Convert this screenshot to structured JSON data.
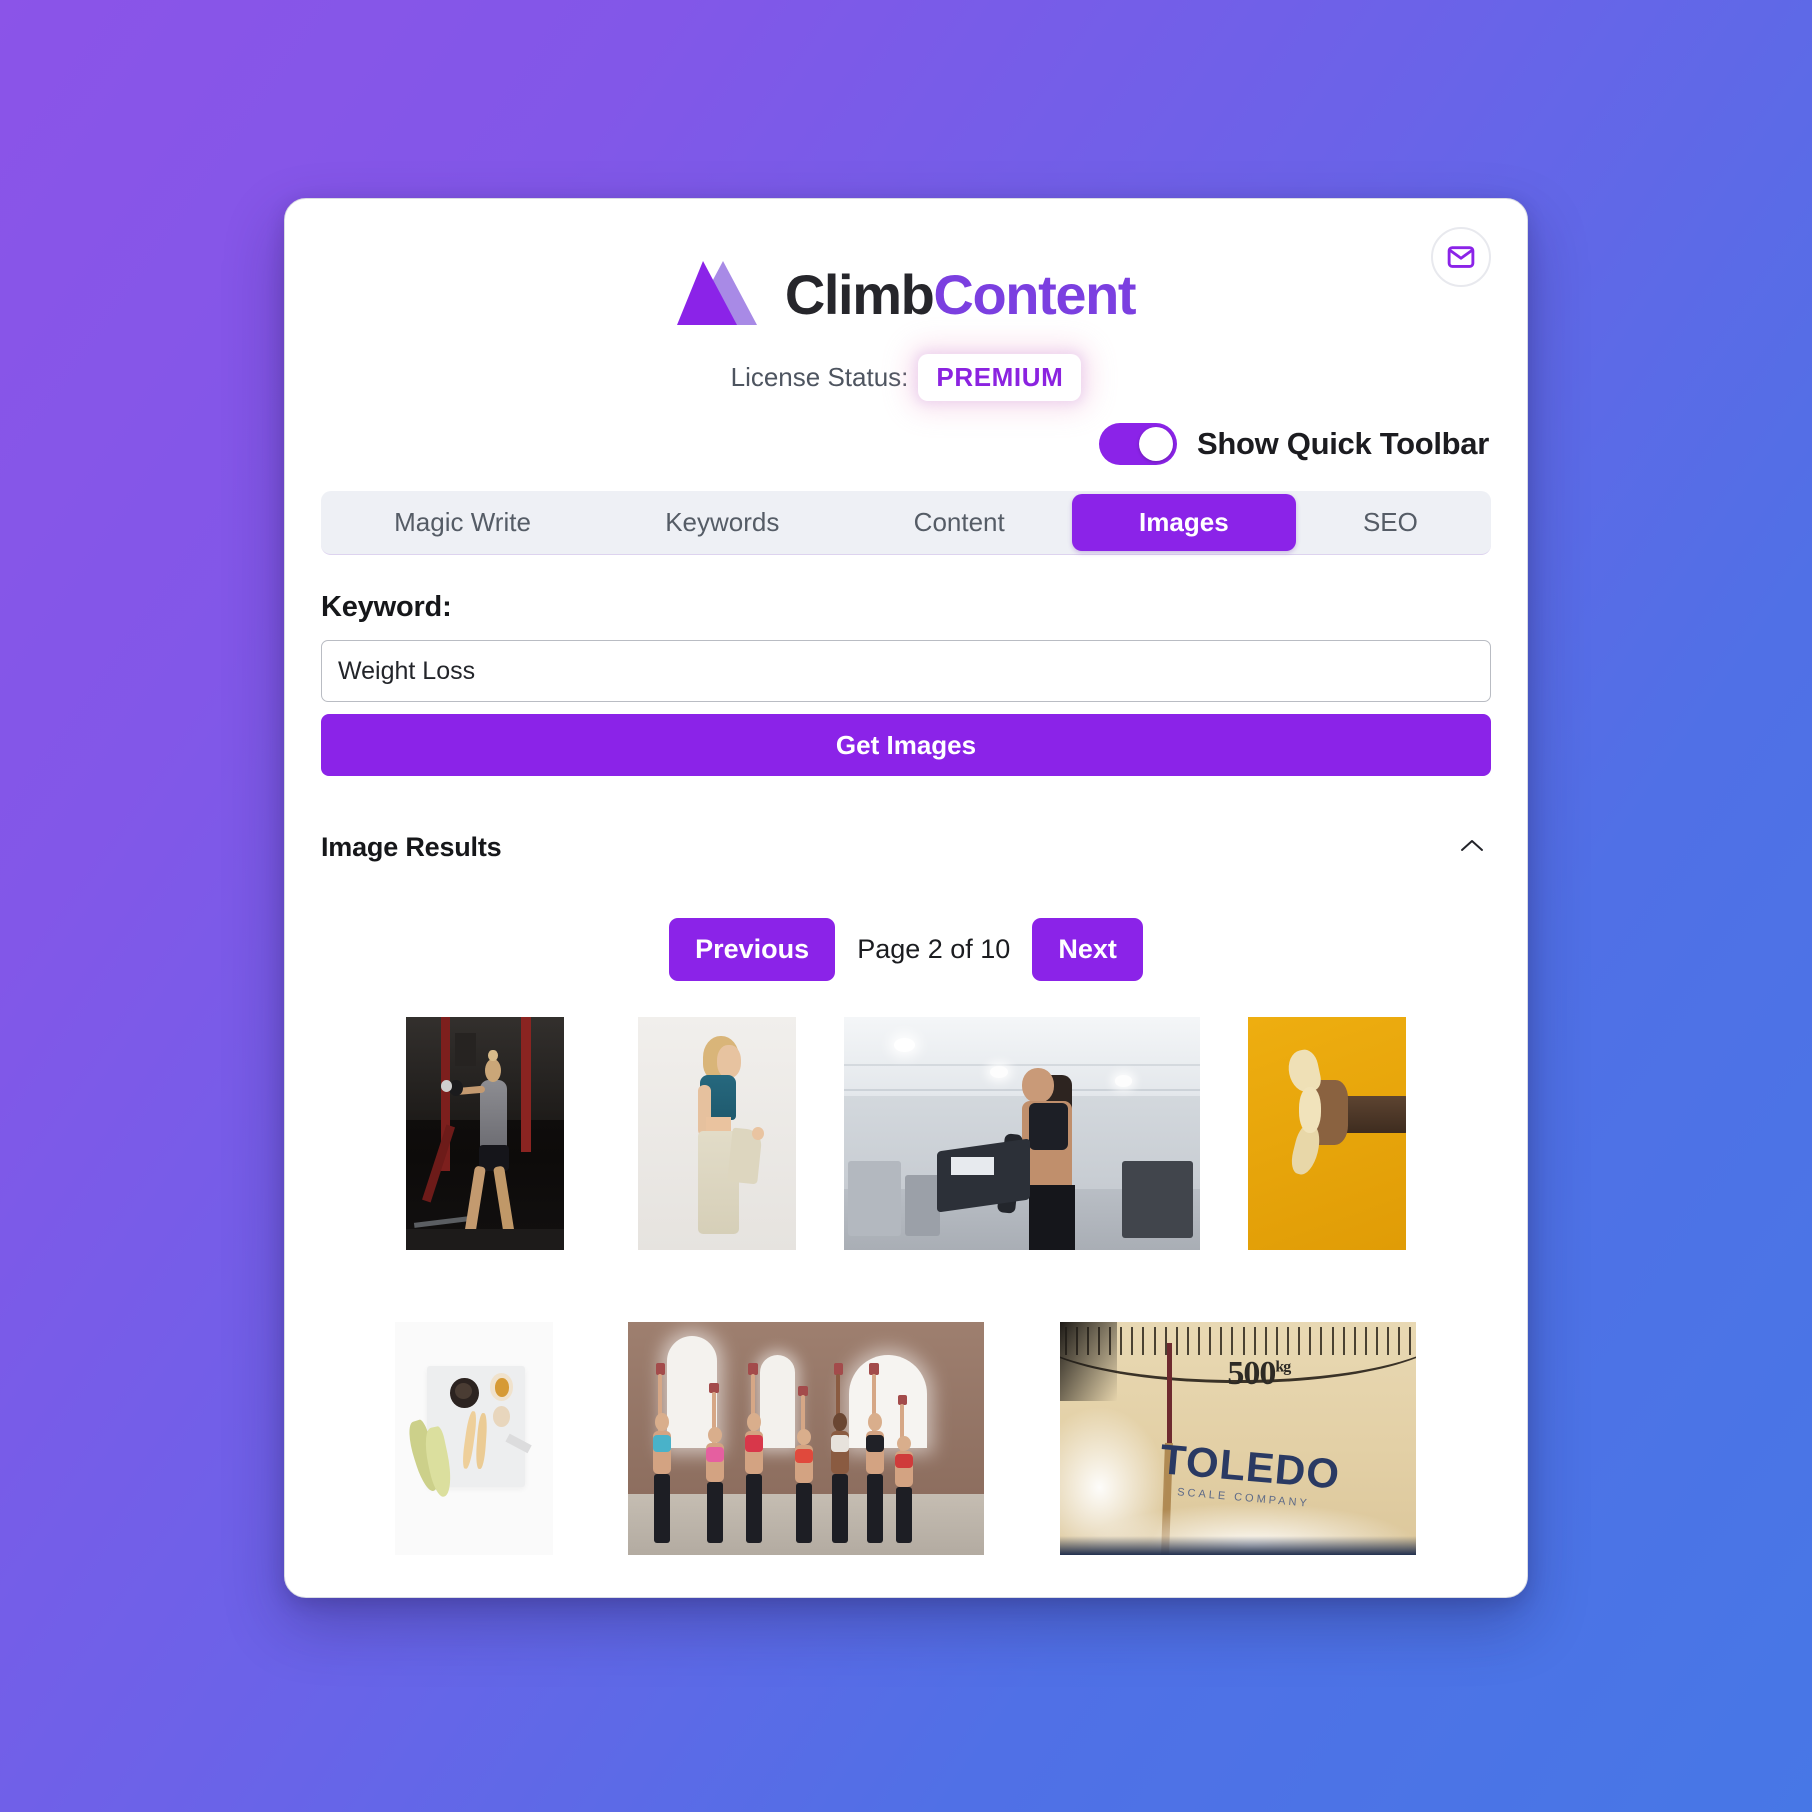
{
  "theme": {
    "accent_purple": "#8b23e8",
    "brand_dark": "#26262b",
    "brand_purple": "#7b3fe0",
    "tabbar_bg": "#eef0f5",
    "page_gradient_from": "#8b54e8",
    "page_gradient_to": "#4777e6"
  },
  "header": {
    "mail_icon": "envelope-icon",
    "brand_first": "Climb",
    "brand_second": "Content",
    "license_label": "License Status:",
    "license_value": "PREMIUM",
    "toggle_label": "Show Quick Toolbar",
    "toggle_state": "on"
  },
  "tabs": [
    {
      "label": "Magic Write",
      "active": false
    },
    {
      "label": "Keywords",
      "active": false
    },
    {
      "label": "Content",
      "active": false
    },
    {
      "label": "Images",
      "active": true
    },
    {
      "label": "SEO",
      "active": false
    }
  ],
  "form": {
    "keyword_label": "Keyword:",
    "keyword_value": "Weight Loss",
    "keyword_placeholder": "Weight Loss",
    "submit_label": "Get Images"
  },
  "results": {
    "title": "Image Results",
    "collapse_icon": "chevron-up-icon",
    "pager": {
      "previous_label": "Previous",
      "page_text": "Page 2 of 10",
      "next_label": "Next",
      "current_page": 2,
      "total_pages": 10
    },
    "images": [
      {
        "alt": "woman swinging kettlebell in dark gym"
      },
      {
        "alt": "woman wearing oversized pants after weight loss"
      },
      {
        "alt": "woman exercising on cardio machine in gym"
      },
      {
        "alt": "hand squeezing banana on yellow background"
      },
      {
        "alt": "bananas and eggs flat lay on white board"
      },
      {
        "alt": "group fitness class lifting dumbbells in brick studio"
      },
      {
        "alt": "vintage Toledo scale dial reading 500 kg"
      }
    ],
    "scale_image_text": {
      "value": "500",
      "unit": "kg",
      "brand": "TOLEDO",
      "subtext": "SCALE COMPANY"
    }
  }
}
